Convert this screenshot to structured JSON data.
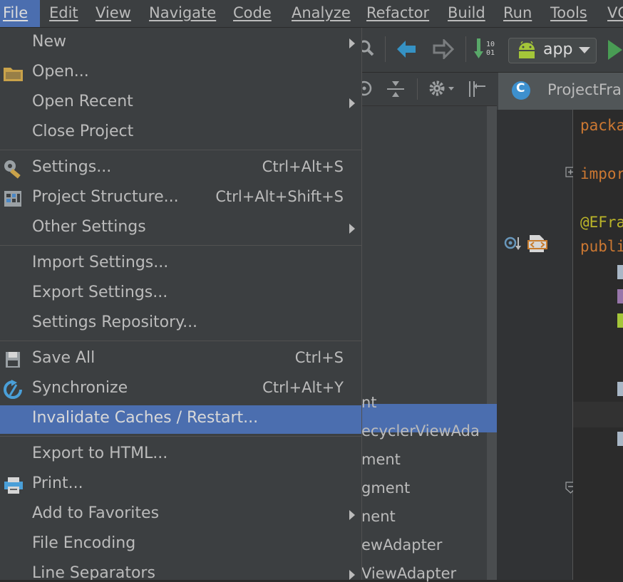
{
  "menubar": {
    "items": [
      "File",
      "Edit",
      "View",
      "Navigate",
      "Code",
      "Analyze",
      "Refactor",
      "Build",
      "Run",
      "Tools",
      "VC"
    ]
  },
  "toolbar": {
    "run_config": "app"
  },
  "editor": {
    "tab_label": "ProjectFra",
    "tab_icon_letter": "C",
    "code_lines": [
      "packa",
      "impor",
      "@EFra",
      "publi"
    ]
  },
  "project_tree": {
    "rows": [
      "nt",
      "ecyclerViewAda",
      "ment",
      "gment",
      "nent",
      "ewAdapter",
      "ViewAdapter"
    ]
  },
  "file_menu": {
    "items": [
      {
        "label": "New",
        "shortcut": "",
        "submenu": true
      },
      {
        "label": "Open...",
        "shortcut": "",
        "submenu": false
      },
      {
        "label": "Open Recent",
        "shortcut": "",
        "submenu": true
      },
      {
        "label": "Close Project",
        "shortcut": "",
        "submenu": false
      },
      {
        "label": "Settings...",
        "shortcut": "Ctrl+Alt+S",
        "submenu": false
      },
      {
        "label": "Project Structure...",
        "shortcut": "Ctrl+Alt+Shift+S",
        "submenu": false
      },
      {
        "label": "Other Settings",
        "shortcut": "",
        "submenu": true
      },
      {
        "label": "Import Settings...",
        "shortcut": "",
        "submenu": false
      },
      {
        "label": "Export Settings...",
        "shortcut": "",
        "submenu": false
      },
      {
        "label": "Settings Repository...",
        "shortcut": "",
        "submenu": false
      },
      {
        "label": "Save All",
        "shortcut": "Ctrl+S",
        "submenu": false
      },
      {
        "label": "Synchronize",
        "shortcut": "Ctrl+Alt+Y",
        "submenu": false
      },
      {
        "label": "Invalidate Caches / Restart...",
        "shortcut": "",
        "submenu": false
      },
      {
        "label": "Export to HTML...",
        "shortcut": "",
        "submenu": false
      },
      {
        "label": "Print...",
        "shortcut": "",
        "submenu": false
      },
      {
        "label": "Add to Favorites",
        "shortcut": "",
        "submenu": true
      },
      {
        "label": "File Encoding",
        "shortcut": "",
        "submenu": false
      },
      {
        "label": "Line Separators",
        "shortcut": "",
        "submenu": true
      }
    ]
  },
  "colors": {
    "selection": "#4b6eaf",
    "menu_bg": "#3c3f41",
    "editor_bg": "#2b2b2b",
    "keyword": "#cc7832",
    "annotation": "#bbb529"
  }
}
